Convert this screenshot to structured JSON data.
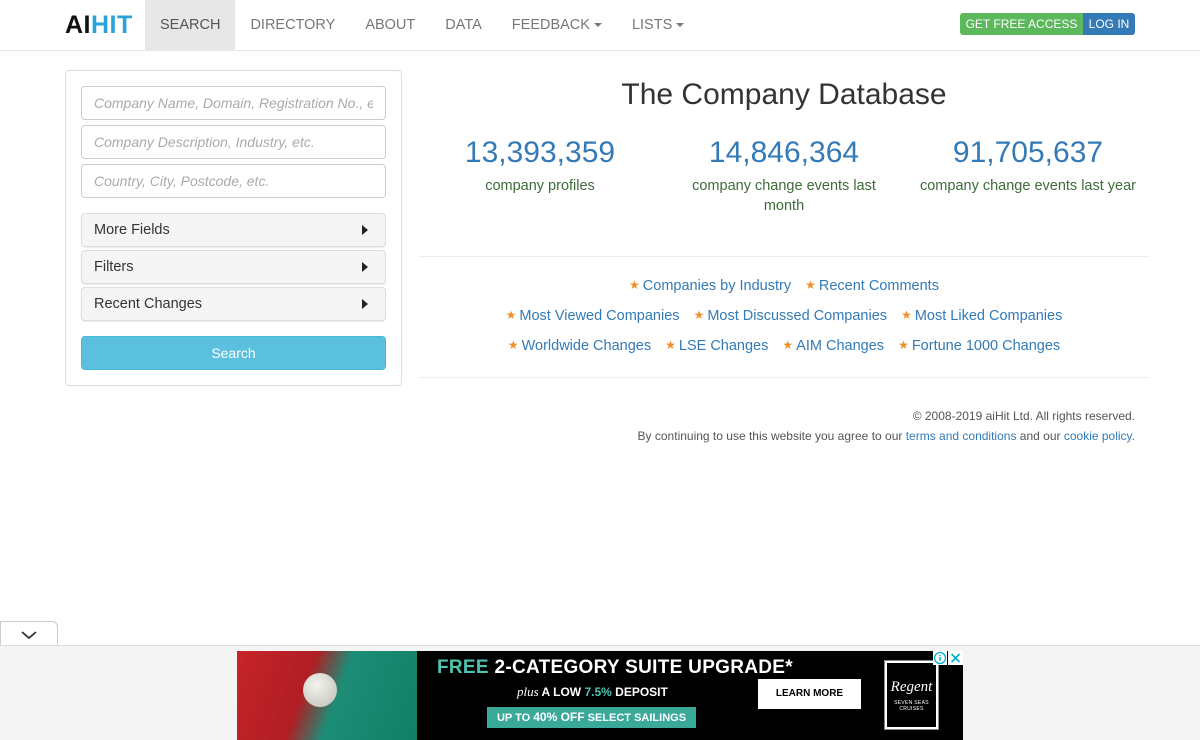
{
  "brand": {
    "logo_part1": "AI",
    "logo_part2": "HIT"
  },
  "nav": {
    "items": [
      {
        "label": "SEARCH"
      },
      {
        "label": "DIRECTORY"
      },
      {
        "label": "ABOUT"
      },
      {
        "label": "DATA"
      },
      {
        "label": "FEEDBACK"
      },
      {
        "label": "LISTS"
      }
    ],
    "active": "SEARCH",
    "get_access_label": "GET FREE ACCESS",
    "login_label": "LOG IN"
  },
  "search": {
    "name_placeholder": "Company Name, Domain, Registration No., e",
    "description_placeholder": "Company Description, Industry, etc.",
    "location_placeholder": "Country, City, Postcode, etc.",
    "sections": [
      {
        "label": "More Fields"
      },
      {
        "label": "Filters"
      },
      {
        "label": "Recent Changes"
      }
    ],
    "button_label": "Search"
  },
  "main": {
    "title": "The Company Database",
    "stats": [
      {
        "value": "13,393,359",
        "label": "company profiles"
      },
      {
        "value": "14,846,364",
        "label": "company change events last month"
      },
      {
        "value": "91,705,637",
        "label": "company change events last year"
      }
    ],
    "link_rows": [
      [
        "Companies by Industry",
        "Recent Comments"
      ],
      [
        "Most Viewed Companies",
        "Most Discussed Companies",
        "Most Liked Companies"
      ],
      [
        "Worldwide Changes",
        "LSE Changes",
        "AIM Changes",
        "Fortune 1000 Changes"
      ]
    ]
  },
  "footer": {
    "copyright": "© 2008-2019 aiHit Ltd. All rights reserved.",
    "terms_prefix": "By continuing to use this website you agree to our",
    "terms_link": "terms and conditions",
    "terms_middle": "and our",
    "cookie_link": "cookie policy",
    "terms_suffix": "."
  },
  "ad": {
    "headline_free": "FREE",
    "headline_rest": " 2-CATEGORY SUITE UPGRADE*",
    "sub_plus": "plus",
    "sub_a_low": " A LOW ",
    "sub_pct": "7.5%",
    "sub_deposit": " DEPOSIT",
    "strip_upto": "UP TO ",
    "strip_pct": "40% OFF",
    "strip_rest": " SELECT SAILINGS",
    "cta": "LEARN MORE",
    "brand_name": "Regent",
    "brand_tag": "SEVEN SEAS CRUISES"
  },
  "colors": {
    "link": "#337ab7",
    "stat_label": "#3d6b39",
    "star": "#f0902a",
    "access_button": "#5cb85c",
    "login_button": "#337ab7",
    "search_button": "#5bc0de",
    "logo_hit": "#2aa3dc"
  },
  "icons": {
    "star": "star-icon",
    "caret": "caret-down-icon",
    "section_toggle": "caret-right-icon",
    "collapse": "chevron-down-icon",
    "ad_info": "info-icon",
    "ad_close": "close-icon"
  }
}
